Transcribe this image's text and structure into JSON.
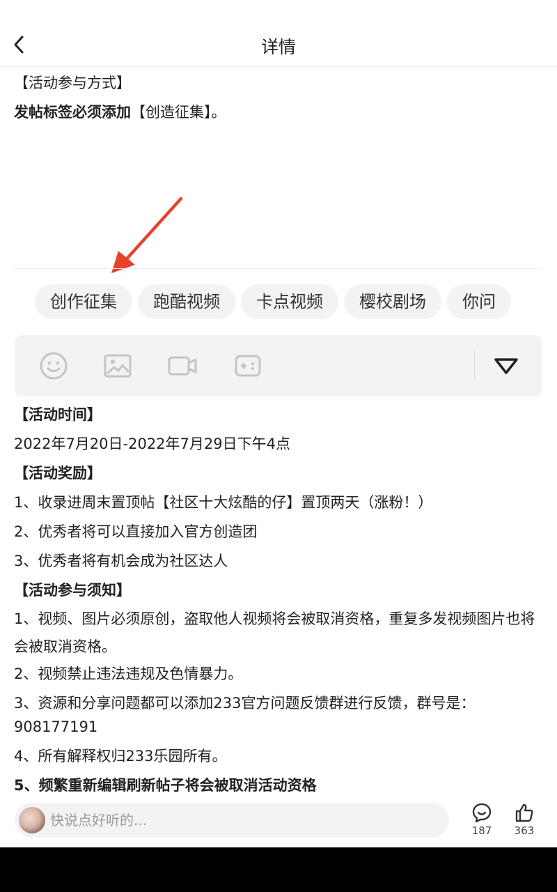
{
  "header": {
    "title": "详情"
  },
  "intro": {
    "heading": "【活动参与方式】",
    "line_bold": "发帖标签必须添加",
    "line_normal": "【创造征集】。"
  },
  "tags": [
    "创作征集",
    "跑酷视频",
    "卡点视频",
    "樱校剧场",
    "你问"
  ],
  "toolbar": {
    "icons": [
      "emoji-icon",
      "image-icon",
      "video-icon",
      "gamepad-icon",
      "collapse-triangle-icon"
    ]
  },
  "body": {
    "time_heading": "【活动时间】",
    "time_value": "2022年7月20日-2022年7月29日下午4点",
    "reward_heading": "【活动奖励】",
    "reward_1": "1、收录进周末置顶帖【社区十大炫酷的仔】置顶两天（涨粉！）",
    "reward_2": "2、优秀者将可以直接加入官方创造团",
    "reward_3": "3、优秀者将有机会成为社区达人",
    "notice_heading": "【活动参与须知】",
    "notice_1": "1、视频、图片必须原创，盗取他人视频将会被取消资格，重复多发视频图片也将会被取消资格。",
    "notice_2": "2、视频禁止违法违规及色情暴力。",
    "notice_3a": "3、资源和分享问题都可以添加233官方问题反馈群进行反馈，群号是：",
    "notice_3b": "908177191",
    "notice_4": "4、所有解释权归233乐园所有。",
    "notice_5": "5、频繁重新编辑刷新帖子将会被取消活动资格"
  },
  "footer": {
    "comment_placeholder": "快说点好听的...",
    "comment_count": "187",
    "like_count": "363"
  },
  "colors": {
    "arrow": "#e8412c",
    "tag_bg": "#f3f3f3",
    "nav_bar": "#000000"
  }
}
